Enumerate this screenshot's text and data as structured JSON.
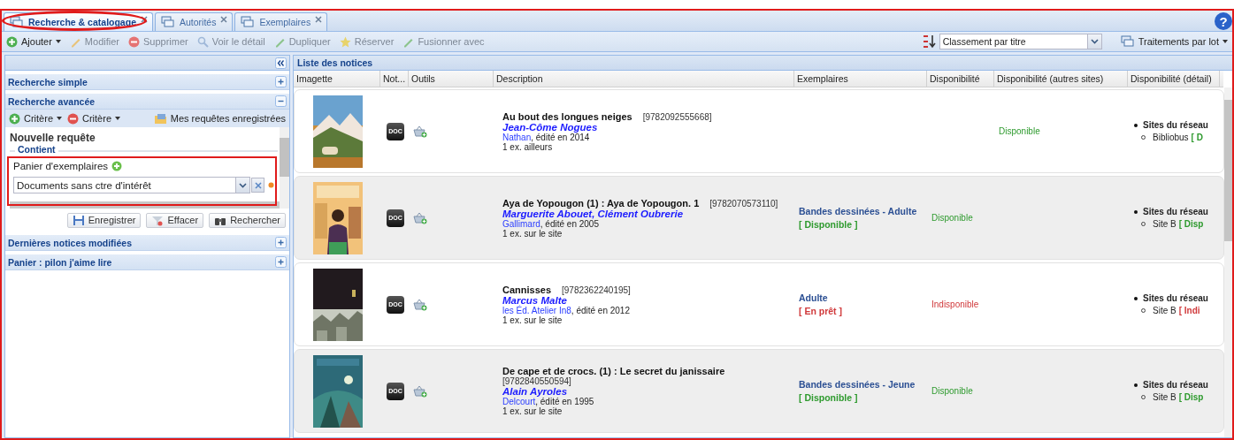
{
  "window": {
    "highlighted": true,
    "help": "?"
  },
  "tabs": [
    {
      "label": "Recherche & catalogage",
      "selected": true,
      "highlighted": true
    },
    {
      "label": "Autorités",
      "selected": false,
      "highlighted": false
    },
    {
      "label": "Exemplaires",
      "selected": false,
      "highlighted": false
    }
  ],
  "toolbar": {
    "actions": [
      {
        "label": "Ajouter",
        "disabled": false,
        "menu": true,
        "kind": "add"
      },
      {
        "label": "Modifier",
        "disabled": true,
        "menu": false,
        "kind": "edit"
      },
      {
        "label": "Supprimer",
        "disabled": true,
        "menu": false,
        "kind": "delete"
      },
      {
        "label": "Voir le détail",
        "disabled": true,
        "menu": false,
        "kind": "view"
      },
      {
        "label": "Dupliquer",
        "disabled": true,
        "menu": false,
        "kind": "duplicate"
      },
      {
        "label": "Réserver",
        "disabled": true,
        "menu": false,
        "kind": "reserve"
      },
      {
        "label": "Fusionner avec",
        "disabled": true,
        "menu": false,
        "kind": "merge"
      }
    ],
    "sort": {
      "value": "Classement par titre"
    },
    "batch": {
      "label": "Traitements par lot"
    }
  },
  "sidebar": {
    "sections": [
      {
        "title": "Recherche simple",
        "expanded": false
      },
      {
        "title": "Recherche avancée",
        "expanded": true,
        "criteria_buttons": [
          {
            "label": "Critère",
            "kind": "add"
          },
          {
            "label": "Critère",
            "kind": "remove"
          }
        ],
        "saved_queries": "Mes requêtes enregistrées",
        "query": {
          "title": "Nouvelle requête",
          "group": "Contient",
          "field_label": "Panier d'exemplaires",
          "field_value": "Documents sans ctre d'intérêt",
          "highlighted": true
        },
        "buttons": [
          {
            "label": "Enregistrer",
            "kind": "save"
          },
          {
            "label": "Effacer",
            "kind": "clear"
          },
          {
            "label": "Rechercher",
            "kind": "search"
          }
        ]
      },
      {
        "title": "Dernières notices modifiées",
        "expanded": false
      },
      {
        "title": "Panier : pilon j'aime lire",
        "expanded": false
      }
    ]
  },
  "list": {
    "title": "Liste des notices",
    "columns": [
      "Imagette",
      "Not...",
      "Outils",
      "Description",
      "Exemplaires",
      "Disponibilité",
      "Disponibilité (autres sites)",
      "Disponibilité (détail)"
    ],
    "rows": [
      {
        "title": "Au bout des longues neiges",
        "isbn": "[9782092555668]",
        "authors": "Jean-Côme Nogues",
        "publisher": "Nathan",
        "edition": ", édité en 2014",
        "copies": "1 ex. ailleurs",
        "doc": "DOC",
        "other_sites": "Disponible",
        "other_available": true,
        "network": "Sites du réseau",
        "site": "Bibliobus",
        "site_status": "[ D",
        "site_available": true
      },
      {
        "title": "Aya de Yopougon (1) : Aya de Yopougon. 1",
        "isbn": "[9782070573110]",
        "authors": "Marguerite Abouet, Clément Oubrerie",
        "publisher": "Gallimard",
        "edition": ", édité en 2005",
        "copies": "1 ex. sur le site",
        "doc": "DOC",
        "copy_section": "Bandes dessinées - Adulte",
        "copy_status": "[ Disponible ]",
        "copy_available": true,
        "availability": "Disponible",
        "availability_available": true,
        "network": "Sites du réseau",
        "site": "Site B",
        "site_status": "[ Disp",
        "site_available": true
      },
      {
        "title": "Cannisses",
        "isbn": "[9782362240195]",
        "authors": "Marcus Malte",
        "publisher": "les Éd. Atelier In8",
        "edition": ", édité en 2012",
        "copies": "1 ex. sur le site",
        "doc": "DOC",
        "copy_section": "Adulte",
        "copy_status": "[ En prêt ]",
        "copy_available": false,
        "availability": "Indisponible",
        "availability_available": false,
        "network": "Sites du réseau",
        "site": "Site B",
        "site_status": "[ Indi",
        "site_available": false
      },
      {
        "title": "De cape et de crocs. (1) : Le secret du janissaire",
        "isbn": "[9782840550594]",
        "authors": "Alain Ayroles",
        "publisher": "Delcourt",
        "edition": ", édité en 1995",
        "copies": "1 ex. sur le site",
        "doc": "DOC",
        "copy_section": "Bandes dessinées - Jeune",
        "copy_status": "[ Disponible ]",
        "copy_available": true,
        "availability": "Disponible",
        "availability_available": true,
        "network": "Sites du réseau",
        "site": "Site B",
        "site_status": "[ Disp",
        "site_available": true
      }
    ]
  }
}
